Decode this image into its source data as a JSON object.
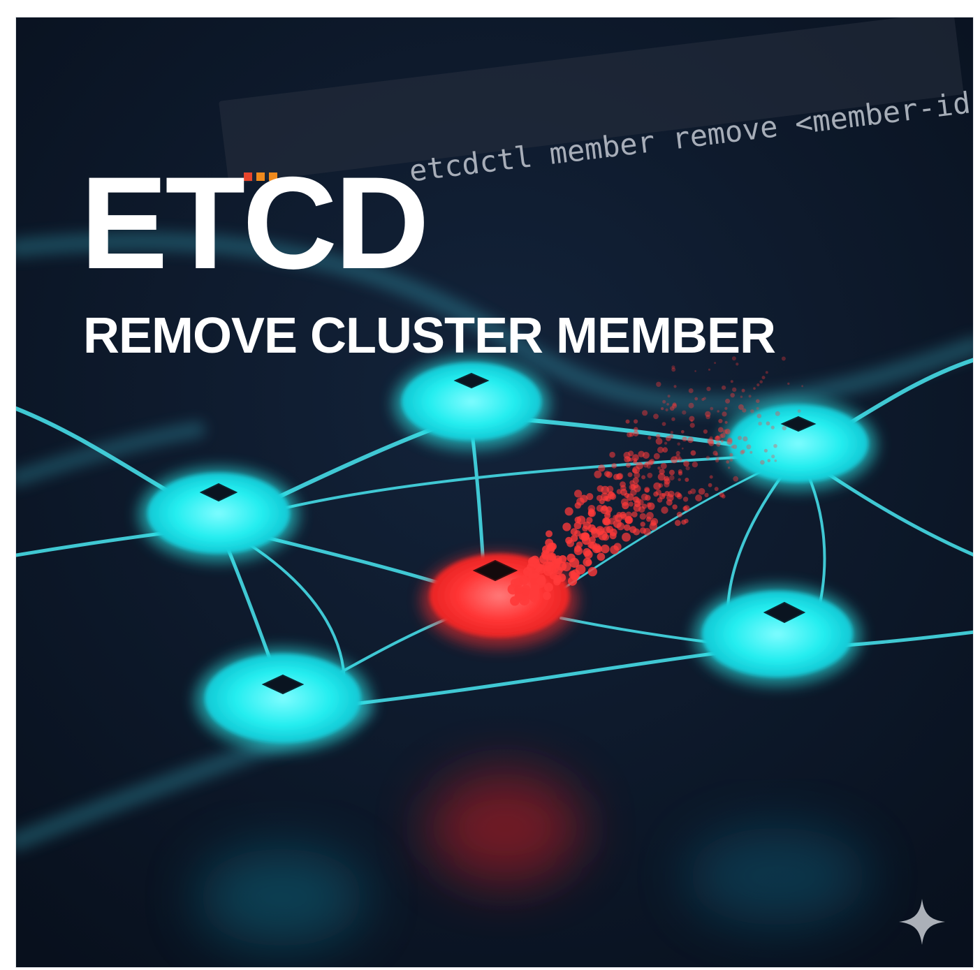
{
  "title": "ETCD",
  "subtitle": "REMOVE CLUSTER MEMBER",
  "command": "etcdctl member remove <member-id",
  "colors": {
    "background": "#0c1525",
    "healthy_node": "#2ff0f0",
    "removed_node": "#ff3b3b",
    "link": "#3fd8e0",
    "text": "#ffffff",
    "command_text": "#b4bac4",
    "dot_red": "#e8452c",
    "dot_orange": "#f08a1c"
  },
  "icons": {
    "watermark": "sparkle-icon"
  }
}
